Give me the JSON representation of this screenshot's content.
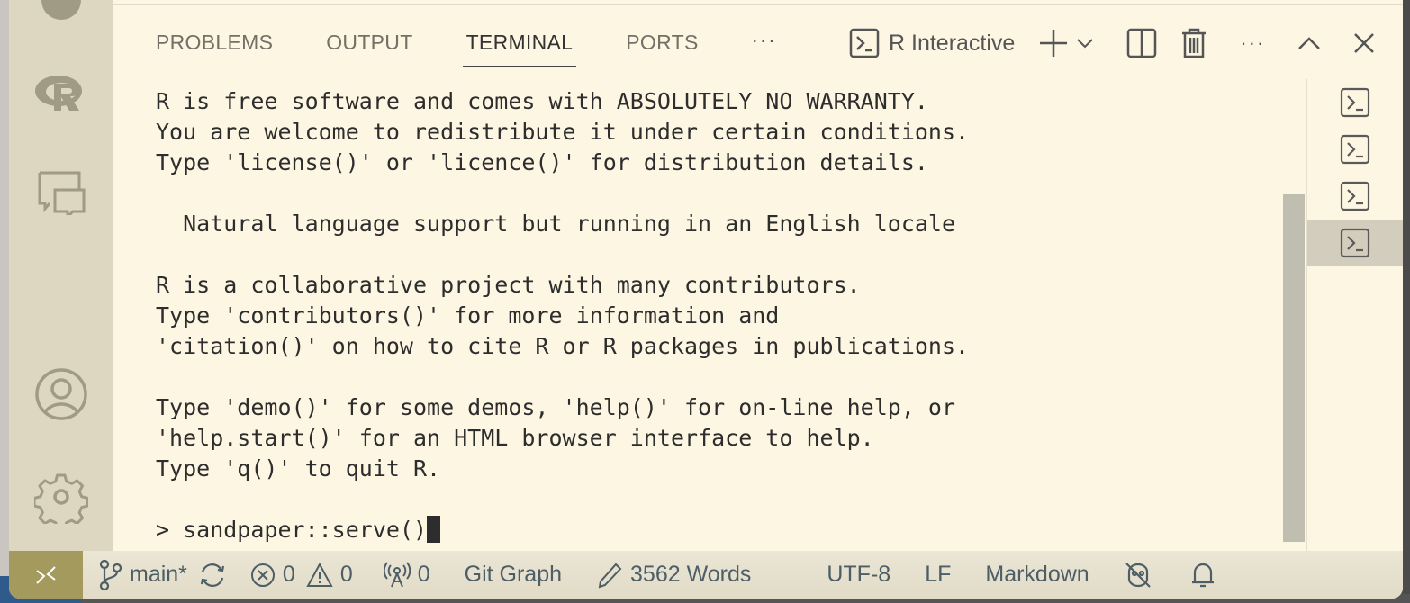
{
  "panel": {
    "tabs": [
      {
        "label": "PROBLEMS",
        "active": false
      },
      {
        "label": "OUTPUT",
        "active": false
      },
      {
        "label": "TERMINAL",
        "active": true
      },
      {
        "label": "PORTS",
        "active": false
      }
    ],
    "more_label": "···",
    "terminal_name": "R Interactive",
    "actions": [
      "new-terminal",
      "terminal-dropdown",
      "split-terminal",
      "kill-terminal",
      "more-actions",
      "maximize-panel",
      "close-panel"
    ]
  },
  "terminal": {
    "lines": [
      "R is free software and comes with ABSOLUTELY NO WARRANTY.",
      "You are welcome to redistribute it under certain conditions.",
      "Type 'license()' or 'licence()' for distribution details.",
      "",
      "  Natural language support but running in an English locale",
      "",
      "R is a collaborative project with many contributors.",
      "Type 'contributors()' for more information and",
      "'citation()' on how to cite R or R packages in publications.",
      "",
      "Type 'demo()' for some demos, 'help()' for on-line help, or",
      "'help.start()' for an HTML browser interface to help.",
      "Type 'q()' to quit R.",
      ""
    ],
    "prompt": "> sandpaper::serve()",
    "terminal_instances": 4,
    "active_instance": 4
  },
  "activity_bar": {
    "items": [
      "r-logo",
      "chat",
      "accounts",
      "settings"
    ]
  },
  "status_bar": {
    "branch": "main*",
    "errors": "0",
    "warnings": "0",
    "ports": "0",
    "git_graph": "Git Graph",
    "words": "3562 Words",
    "encoding": "UTF-8",
    "eol": "LF",
    "language": "Markdown"
  },
  "colors": {
    "background": "#fdf6e3",
    "activity_bar": "#ddd6c1",
    "remote_button": "#a49a5e",
    "status_text": "#4e5e66"
  }
}
